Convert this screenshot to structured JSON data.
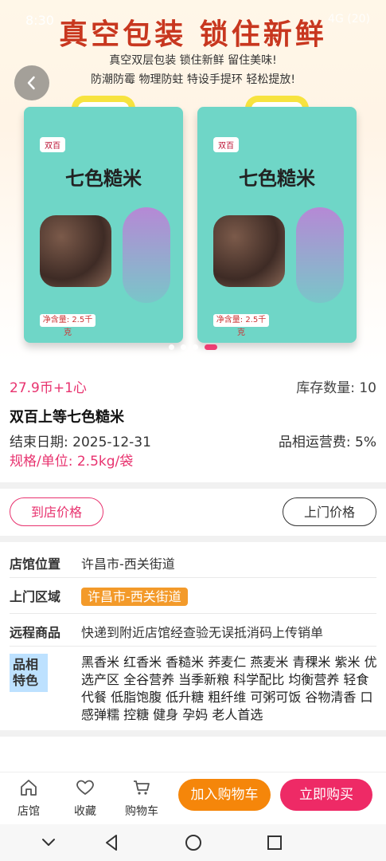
{
  "status": {
    "time": "8:30",
    "right_text": "4G (20)"
  },
  "hero": {
    "headline": "真空包装 锁住新鲜",
    "subline1": "真空双层包装 锁住新鲜 留住美味!",
    "subline2": "防潮防霉  物理防蛀  特设手提环  轻松提放!",
    "bag_brand": "七色糙米",
    "bag_logo": "双百",
    "bag_net": "净含量: 2.5千克",
    "dots": 4,
    "active_dot": 3
  },
  "product": {
    "price": "27.9币+1心",
    "stock": "库存数量:  10",
    "name": "双百上等七色糙米",
    "end_date": "结束日期:  2025-12-31",
    "fee": "品相运营费:  5%",
    "spec": "规格/单位:  2.5kg/袋"
  },
  "buttons": {
    "store_price": "到店价格",
    "home_price": "上门价格"
  },
  "details": [
    {
      "key": "店馆位置",
      "value": "许昌市-西关街道"
    },
    {
      "key": "上门区域",
      "value": "许昌市-西关街道"
    },
    {
      "key": "远程商品",
      "value": "快递到附近店馆经查验无误抵消码上传销单"
    }
  ],
  "feature_label": "品相特色",
  "features": "黑香米 红香米 香糙米 荞麦仁 燕麦米 青稞米 紫米 优选产区 全谷营养 当季新粮 科学配比 均衡营养 轻食代餐 低脂饱腹 低升糖 粗纤维 可粥可饭 谷物清香 口感弹糯 控糖 健身 孕妈 老人首选",
  "bottom": {
    "tab_store": "店馆",
    "tab_fav": "收藏",
    "tab_cart": "购物车",
    "add_cart": "加入购物车",
    "buy_now": "立即购买"
  }
}
